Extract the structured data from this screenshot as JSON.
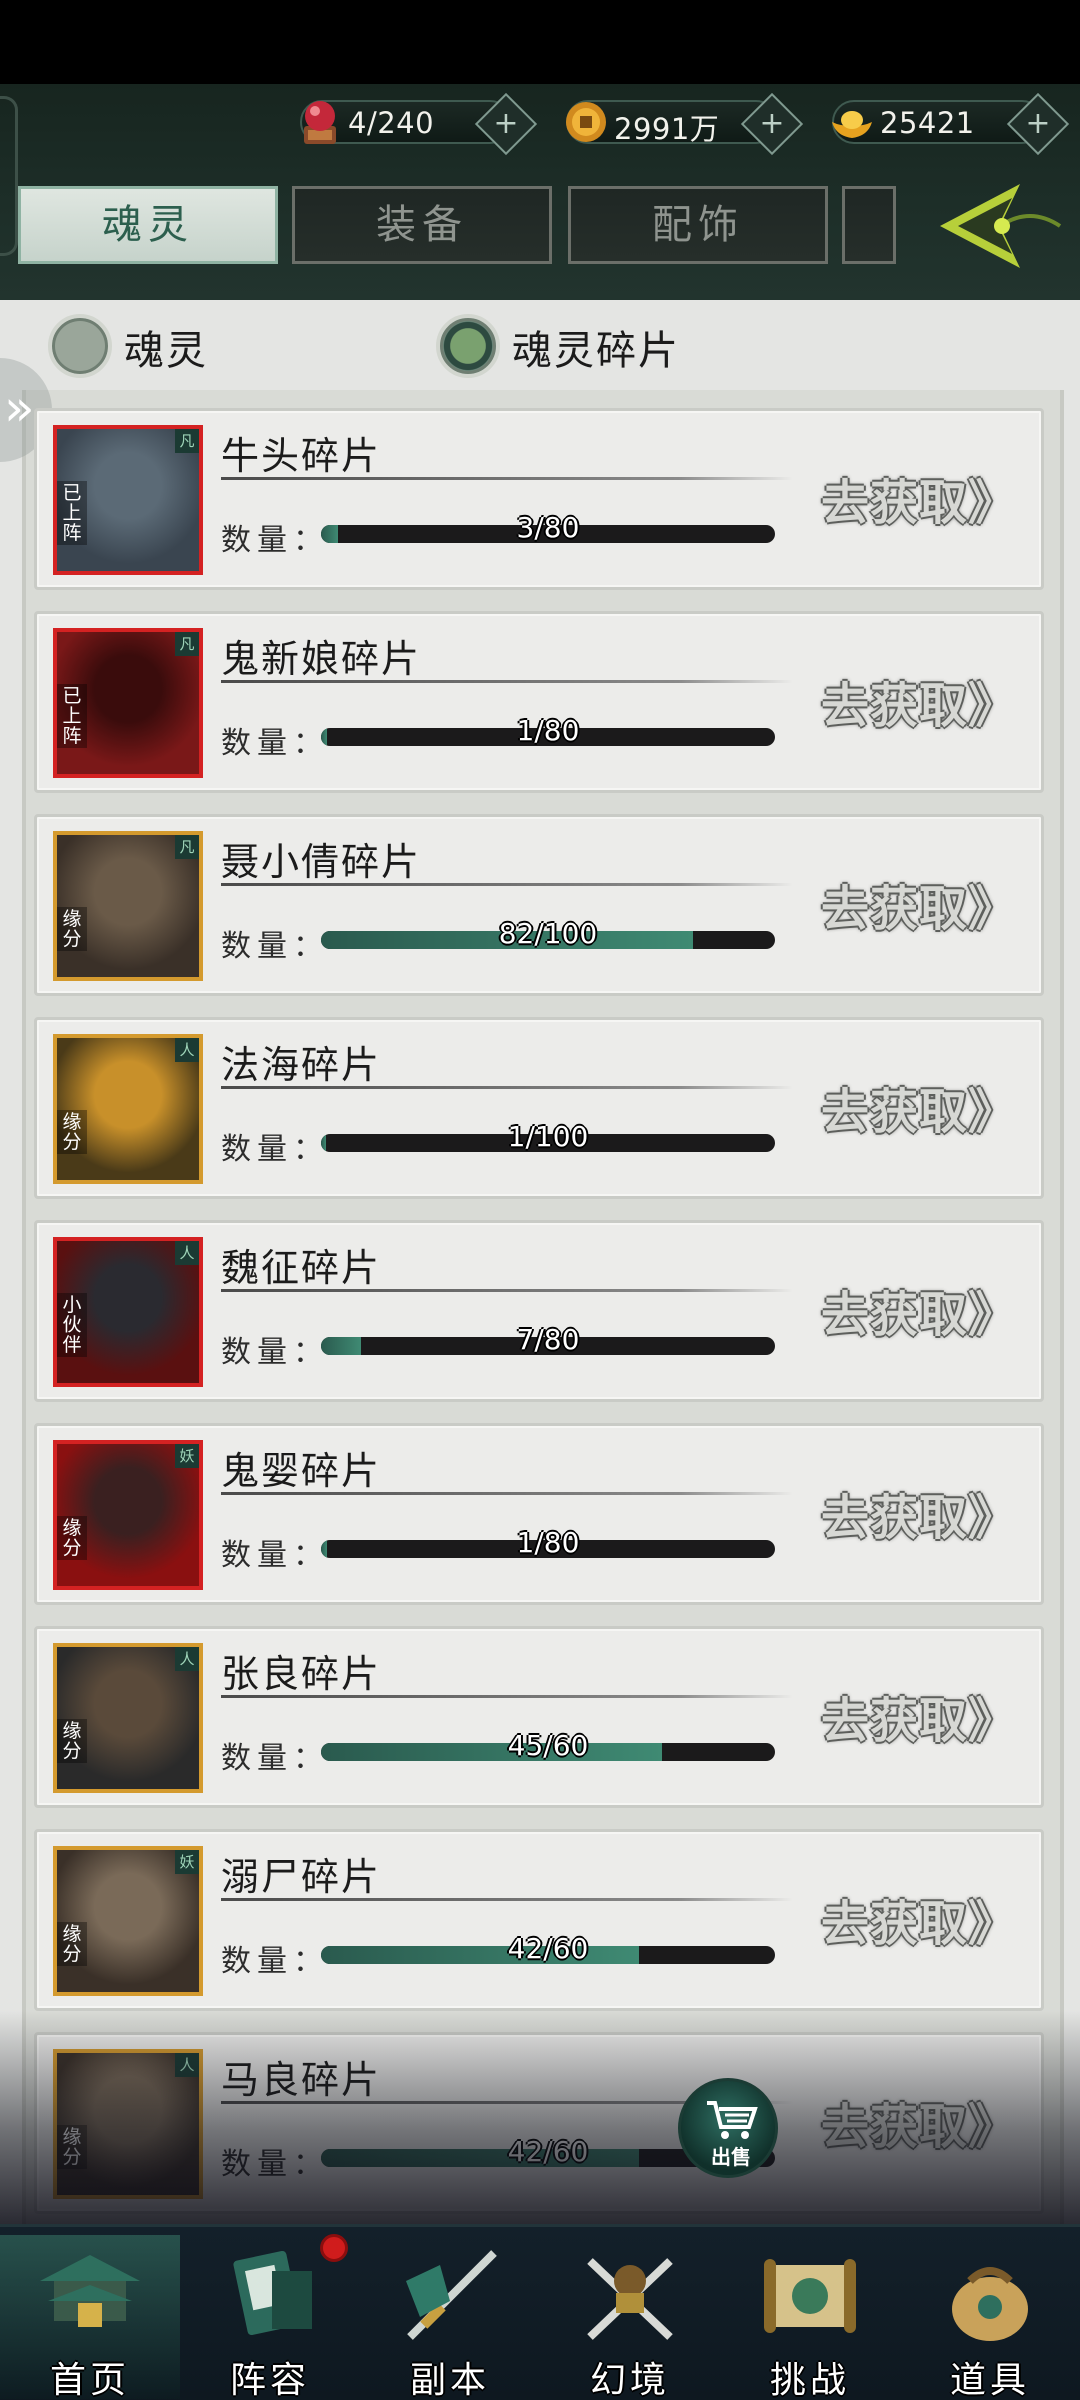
{
  "header": {
    "currencies": [
      {
        "name": "stamina",
        "value": "4/240",
        "icon": "red-orb-icon"
      },
      {
        "name": "coins",
        "value": "2991万",
        "icon": "coin-icon"
      },
      {
        "name": "gold",
        "value": "25421",
        "icon": "gold-ingot-icon"
      }
    ],
    "tabs": [
      {
        "label": "魂灵",
        "active": true
      },
      {
        "label": "装备",
        "active": false
      },
      {
        "label": "配饰",
        "active": false
      }
    ]
  },
  "filter": {
    "options": [
      {
        "label": "魂灵",
        "selected": false
      },
      {
        "label": "魂灵碎片",
        "selected": true
      }
    ]
  },
  "qty_label": "数量：",
  "goto_label": "去获取》",
  "items": [
    {
      "name": "牛头碎片",
      "progress": "3/80",
      "current": 3,
      "max": 80,
      "tag": "已上阵",
      "frame": "red",
      "rank": "凡"
    },
    {
      "name": "鬼新娘碎片",
      "progress": "1/80",
      "current": 1,
      "max": 80,
      "tag": "已上阵",
      "frame": "red",
      "rank": "凡"
    },
    {
      "name": "聂小倩碎片",
      "progress": "82/100",
      "current": 82,
      "max": 100,
      "tag": "缘分",
      "frame": "gold",
      "rank": "凡"
    },
    {
      "name": "法海碎片",
      "progress": "1/100",
      "current": 1,
      "max": 100,
      "tag": "缘分",
      "frame": "gold",
      "rank": "人"
    },
    {
      "name": "魏征碎片",
      "progress": "7/80",
      "current": 7,
      "max": 80,
      "tag": "小伙伴",
      "frame": "red",
      "rank": "人"
    },
    {
      "name": "鬼婴碎片",
      "progress": "1/80",
      "current": 1,
      "max": 80,
      "tag": "缘分",
      "frame": "red",
      "rank": "妖"
    },
    {
      "name": "张良碎片",
      "progress": "45/60",
      "current": 45,
      "max": 60,
      "tag": "缘分",
      "frame": "gold",
      "rank": "人"
    },
    {
      "name": "溺尸碎片",
      "progress": "42/60",
      "current": 42,
      "max": 60,
      "tag": "缘分",
      "frame": "gold",
      "rank": "妖"
    },
    {
      "name": "马良碎片",
      "progress": "42/60",
      "current": 42,
      "max": 60,
      "tag": "缘分",
      "frame": "gold",
      "rank": "人"
    }
  ],
  "sell_button": {
    "label": "出售",
    "icon": "cart-icon"
  },
  "bottom_nav": [
    {
      "label": "首页",
      "icon": "palace-icon",
      "active": true
    },
    {
      "label": "阵容",
      "icon": "banner-icon",
      "active": false,
      "badge": true
    },
    {
      "label": "副本",
      "icon": "sword-icon",
      "active": false
    },
    {
      "label": "幻境",
      "icon": "crossed-swords-icon",
      "active": false
    },
    {
      "label": "挑战",
      "icon": "scroll-icon",
      "active": false
    },
    {
      "label": "道具",
      "icon": "bag-icon",
      "active": false
    }
  ]
}
